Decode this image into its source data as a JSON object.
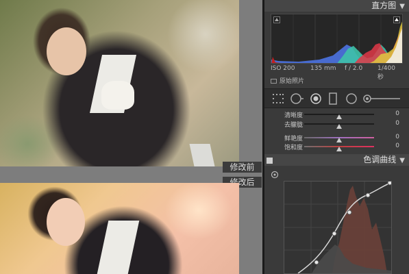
{
  "compare": {
    "before_label": "修改前",
    "after_label": "修改后"
  },
  "histogram": {
    "title": "直方图",
    "iso": "ISO 200",
    "focal": "135 mm",
    "aperture": "f / 2.0",
    "shutter": "1/400 秒",
    "original_photo_label": "原始照片"
  },
  "adjust": {
    "rows": [
      {
        "label": "清晰度",
        "value": "0",
        "thumb_pct": 50
      },
      {
        "label": "去朦胧",
        "value": "0",
        "thumb_pct": 50
      },
      {
        "label": "鲜艳度",
        "value": "0",
        "thumb_pct": 50
      },
      {
        "label": "饱和度",
        "value": "0",
        "thumb_pct": 50
      }
    ]
  },
  "tone_curve": {
    "title": "色调曲线"
  },
  "icons": {
    "collapse": "triangle-down",
    "grid_tool": "grid-icon",
    "crop_tool": "crop-icon",
    "spot_tool": "spot-removal-icon",
    "redeye_tool": "red-eye-icon",
    "gradient_tool": "graduated-filter-icon",
    "radial_tool": "radial-filter-icon",
    "brush_tool": "adjustment-brush-icon"
  },
  "colors": {
    "panel_bg": "#3a3a3a",
    "header_bg": "#464646",
    "compare_bg": "#7d7d7d"
  }
}
